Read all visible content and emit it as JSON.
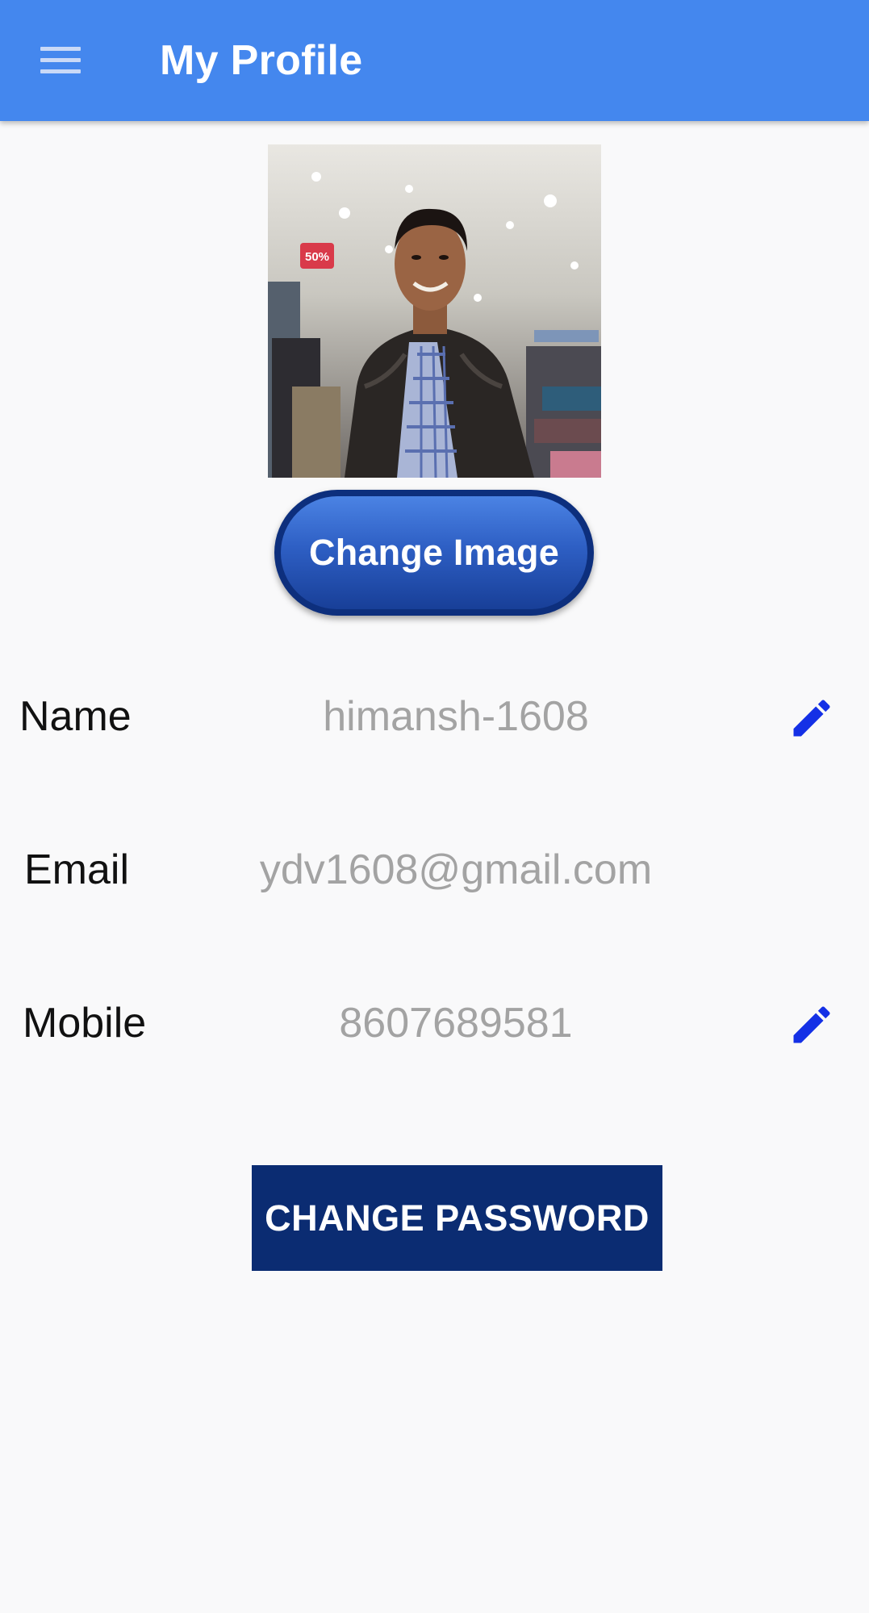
{
  "app_bar": {
    "title": "My Profile",
    "menu_icon": "hamburger-menu-icon",
    "background": "#4487ee"
  },
  "profile": {
    "avatar_alt": "profile photo",
    "change_image_label": "Change Image"
  },
  "fields": [
    {
      "label": "Name",
      "value": "himansh-1608",
      "editable": true
    },
    {
      "label": "Email",
      "value": "ydv1608@gmail.com",
      "editable": false
    },
    {
      "label": "Mobile",
      "value": "8607689581",
      "editable": true
    }
  ],
  "actions": {
    "change_password_label": "CHANGE PASSWORD"
  },
  "colors": {
    "accent": "#4487ee",
    "button_dark": "#0b2c72",
    "edit_icon": "#1430e6",
    "value_text": "#a3a3a3"
  }
}
